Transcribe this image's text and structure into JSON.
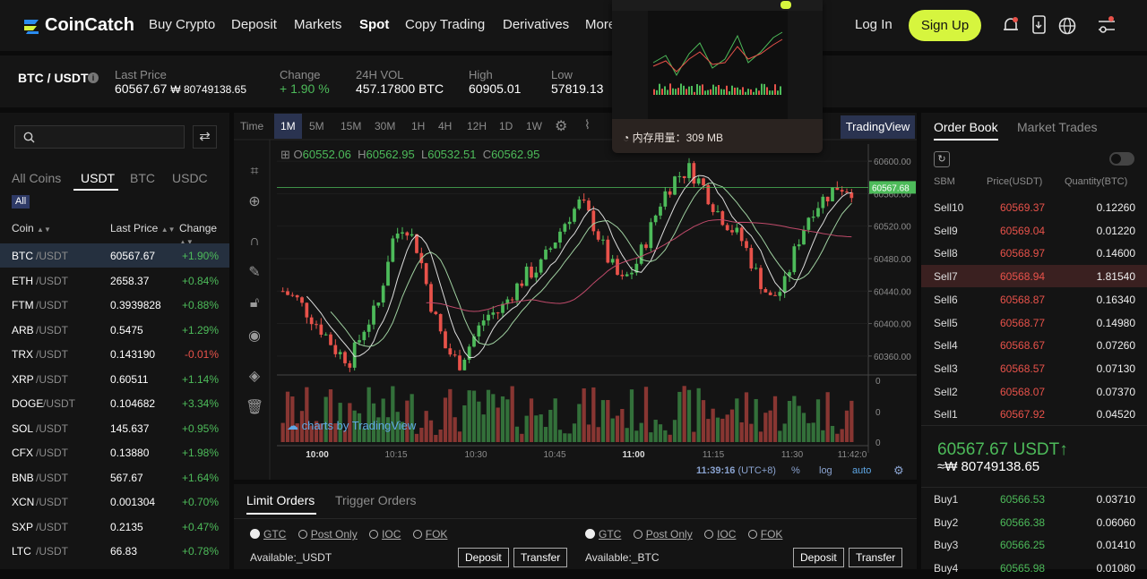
{
  "brand": {
    "name": "CoinCatch",
    "accent": "#d6f53e"
  },
  "nav": {
    "items": [
      "Buy Crypto",
      "Deposit",
      "Markets",
      "Spot",
      "Copy Trading",
      "Derivatives",
      "More"
    ],
    "login": "Log In",
    "signup": "Sign Up"
  },
  "ticker": {
    "pair": "BTC / USDT",
    "last_label": "Last Price",
    "last": "60567.67",
    "last_fiat": "₩ 80749138.65",
    "change_label": "Change",
    "change": "+ 1.90 %",
    "vol_label": "24H VOL",
    "vol": "457.17800 BTC",
    "high_label": "High",
    "high": "60905.01",
    "low_label": "Low",
    "low": "57819.13"
  },
  "popup": {
    "memory": "内存用量：309 MB"
  },
  "market": {
    "tabs": [
      "All Coins",
      "USDT",
      "BTC",
      "USDC"
    ],
    "all_badge": "All",
    "headers": {
      "coin": "Coin",
      "price": "Last Price",
      "change": "Change"
    },
    "rows": [
      {
        "coin": "BTC",
        "quote": "/USDT",
        "price": "60567.67",
        "change": "+1.90%",
        "up": true
      },
      {
        "coin": "ETH",
        "quote": "/USDT",
        "price": "2658.37",
        "change": "+0.84%",
        "up": true
      },
      {
        "coin": "FTM",
        "quote": "/USDT",
        "price": "0.3939828",
        "change": "+0.88%",
        "up": true
      },
      {
        "coin": "ARB",
        "quote": "/USDT",
        "price": "0.5475",
        "change": "+1.29%",
        "up": true
      },
      {
        "coin": "TRX",
        "quote": "/USDT",
        "price": "0.143190",
        "change": "-0.01%",
        "up": false
      },
      {
        "coin": "XRP",
        "quote": "/USDT",
        "price": "0.60511",
        "change": "+1.14%",
        "up": true
      },
      {
        "coin": "DOGE",
        "quote": "/USDT",
        "price": "0.104682",
        "change": "+3.34%",
        "up": true
      },
      {
        "coin": "SOL",
        "quote": "/USDT",
        "price": "145.637",
        "change": "+0.95%",
        "up": true
      },
      {
        "coin": "CFX",
        "quote": "/USDT",
        "price": "0.13880",
        "change": "+1.98%",
        "up": true
      },
      {
        "coin": "BNB",
        "quote": "/USDT",
        "price": "567.67",
        "change": "+1.64%",
        "up": true
      },
      {
        "coin": "XCN",
        "quote": "/USDT",
        "price": "0.001304",
        "change": "+0.70%",
        "up": true
      },
      {
        "coin": "SXP",
        "quote": "/USDT",
        "price": "0.2135",
        "change": "+0.47%",
        "up": true
      },
      {
        "coin": "LTC",
        "quote": "/USDT",
        "price": "66.83",
        "change": "+0.78%",
        "up": true
      }
    ]
  },
  "chart": {
    "timeframes": [
      "Time",
      "1M",
      "5M",
      "15M",
      "30M",
      "1H",
      "4H",
      "12H",
      "1D",
      "1W"
    ],
    "tv_label": "TradingView",
    "ohlc": {
      "o_label": "O",
      "o": "60552.06",
      "h_label": "H",
      "h": "60562.95",
      "l_label": "L",
      "l": "60532.51",
      "c_label": "C",
      "c": "60562.95"
    },
    "price_ticks": [
      "60600.00",
      "60560.00",
      "60520.00",
      "60480.00",
      "60440.00",
      "60400.00",
      "60360.00"
    ],
    "current_price": "60567.68",
    "volume_ticks": [
      "0",
      "0",
      "0"
    ],
    "time_ticks": [
      "10:00",
      "10:15",
      "10:30",
      "10:45",
      "11:00",
      "11:15",
      "11:30",
      "11:42:0"
    ],
    "clock": "11:39:16",
    "tz": "(UTC+8)",
    "opts": [
      "%",
      "log",
      "auto"
    ],
    "watermark": "charts by TradingView"
  },
  "chart_data": {
    "type": "candlestick",
    "x_range": [
      "09:54",
      "11:42"
    ],
    "ylim": [
      60340,
      60610
    ],
    "last": 60567.68
  },
  "orders": {
    "tabs": [
      "Limit Orders",
      "Trigger Orders"
    ],
    "tif": [
      "GTC",
      "Post Only",
      "IOC",
      "FOK"
    ],
    "available_buy": "Available:_USDT",
    "available_sell": "Available:_BTC",
    "deposit": "Deposit",
    "transfer": "Transfer"
  },
  "orderbook": {
    "tabs": [
      "Order Book",
      "Market Trades"
    ],
    "headers": {
      "sbm": "SBM",
      "price": "Price(USDT)",
      "qty": "Quantity(BTC)"
    },
    "sells": [
      {
        "label": "Sell10",
        "price": "60569.37",
        "qty": "0.12260"
      },
      {
        "label": "Sell9",
        "price": "60569.04",
        "qty": "0.01220"
      },
      {
        "label": "Sell8",
        "price": "60568.97",
        "qty": "0.14600"
      },
      {
        "label": "Sell7",
        "price": "60568.94",
        "qty": "1.81540"
      },
      {
        "label": "Sell6",
        "price": "60568.87",
        "qty": "0.16340"
      },
      {
        "label": "Sell5",
        "price": "60568.77",
        "qty": "0.14980"
      },
      {
        "label": "Sell4",
        "price": "60568.67",
        "qty": "0.07260"
      },
      {
        "label": "Sell3",
        "price": "60568.57",
        "qty": "0.07130"
      },
      {
        "label": "Sell2",
        "price": "60568.07",
        "qty": "0.07370"
      },
      {
        "label": "Sell1",
        "price": "60567.92",
        "qty": "0.04520"
      }
    ],
    "mid": "60567.67 USDT↑",
    "mid_fiat": "≈₩ 80749138.65",
    "buys": [
      {
        "label": "Buy1",
        "price": "60566.53",
        "qty": "0.03710"
      },
      {
        "label": "Buy2",
        "price": "60566.38",
        "qty": "0.06060"
      },
      {
        "label": "Buy3",
        "price": "60566.25",
        "qty": "0.01410"
      },
      {
        "label": "Buy4",
        "price": "60565.98",
        "qty": "0.01080"
      }
    ]
  },
  "colors": {
    "up": "#4dbb5a",
    "down": "#e8524a",
    "accent": "#d6f53e"
  }
}
